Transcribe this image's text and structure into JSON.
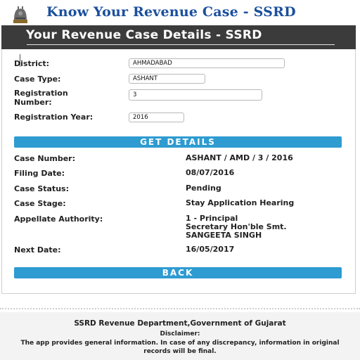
{
  "header": {
    "app_title": "Know Your Revenue Case - SSRD",
    "emblem_icon": "state-emblem-icon",
    "banner_title": "Your Revenue Case Details - SSRD"
  },
  "colors": {
    "title_blue": "#1a4f9c",
    "banner_bg": "#3b3b3b",
    "button_blue": "#2e9bd1"
  },
  "form": {
    "district_label": "District:",
    "district_value": "AHMADABAD",
    "case_type_label": "Case Type:",
    "case_type_value": "ASHANT",
    "registration_number_label": "Registration Number:",
    "registration_number_value": "3",
    "registration_year_label": "Registration Year:",
    "registration_year_value": "2016",
    "get_details_label": "GET DETAILS"
  },
  "details": {
    "case_number_label": "Case Number:",
    "case_number_value": "ASHANT / AMD / 3 / 2016",
    "filing_date_label": "Filing Date:",
    "filing_date_value": "08/07/2016",
    "case_status_label": "Case Status:",
    "case_status_value": "Pending",
    "case_stage_label": "Case Stage:",
    "case_stage_value": "Stay Application Hearing",
    "appellate_authority_label": "Appellate Authority:",
    "appellate_authority_line1": "1 - Principal",
    "appellate_authority_line2": "Secretary  Hon'ble Smt.",
    "appellate_authority_line3": "SANGEETA SINGH",
    "next_date_label": "Next Date:",
    "next_date_value": "16/05/2017",
    "back_label": "BACK"
  },
  "footer": {
    "department": "SSRD Revenue Department,Government of Gujarat",
    "disclaimer_title": "Disclaimer:",
    "disclaimer_text": "The app provides general information. In case of any discrepancy, information in original records will be final."
  }
}
